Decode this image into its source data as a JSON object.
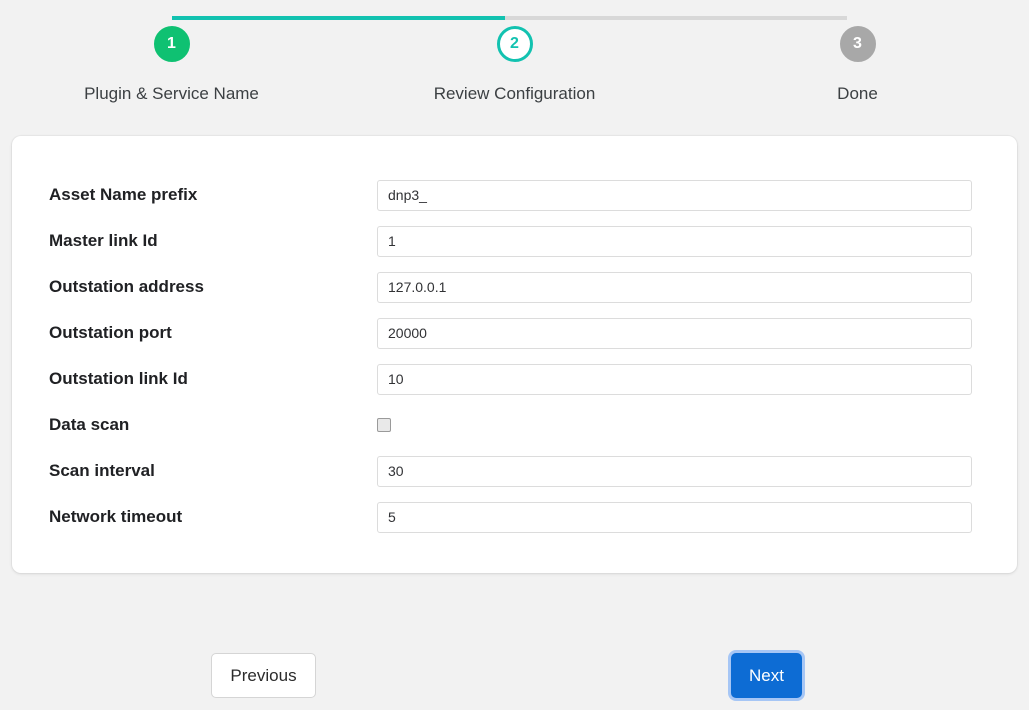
{
  "stepper": {
    "steps": [
      {
        "number": "1",
        "label": "Plugin & Service Name",
        "state": "done"
      },
      {
        "number": "2",
        "label": "Review Configuration",
        "state": "active"
      },
      {
        "number": "3",
        "label": "Done",
        "state": "pending"
      }
    ],
    "colors": {
      "done": "#0fc172",
      "active": "#12c2b0",
      "pending": "#a8a8a8",
      "connector_filled": "#12c2b0",
      "connector_empty": "#d8d8d8"
    }
  },
  "form": {
    "fields": [
      {
        "label": "Asset Name prefix",
        "type": "text",
        "value": "dnp3_"
      },
      {
        "label": "Master link Id",
        "type": "text",
        "value": "1"
      },
      {
        "label": "Outstation address",
        "type": "text",
        "value": "127.0.0.1"
      },
      {
        "label": "Outstation port",
        "type": "text",
        "value": "20000"
      },
      {
        "label": "Outstation link Id",
        "type": "text",
        "value": "10"
      },
      {
        "label": "Data scan",
        "type": "checkbox",
        "checked": false
      },
      {
        "label": "Scan interval",
        "type": "text",
        "value": "30"
      },
      {
        "label": "Network timeout",
        "type": "text",
        "value": "5"
      }
    ]
  },
  "footer": {
    "previous_label": "Previous",
    "next_label": "Next",
    "next_color": "#0d6cd4"
  }
}
